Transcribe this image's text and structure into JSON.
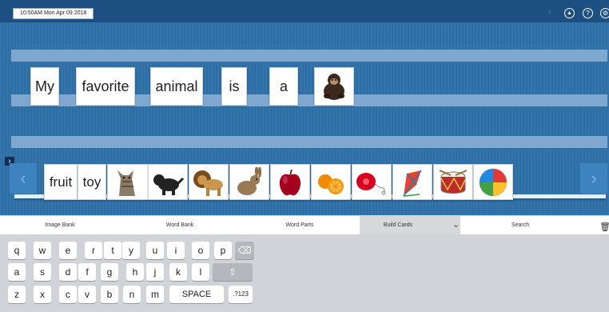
{
  "header": {
    "datetime": "10:50AM Mon Apr 09 2018",
    "icons": [
      "back-icon",
      "cloud-upload-icon",
      "help-icon",
      "gear-icon"
    ]
  },
  "sentence": {
    "words": [
      "My",
      "favorite",
      "animal",
      "is",
      "a"
    ],
    "image": "chimpanzee"
  },
  "bank": {
    "words": [
      "fruit",
      "toy"
    ],
    "images": [
      "cat",
      "puppy",
      "lion",
      "rabbit",
      "apple",
      "orange",
      "yo-yo",
      "kite",
      "drum",
      "beach-ball"
    ]
  },
  "tabs": {
    "image_bank": "Image Bank",
    "word_bank": "Word Bank",
    "word_parts": "Word Parts",
    "build_cards": "Build Cards",
    "search": "Search",
    "active": "Build Cards"
  },
  "keyboard": {
    "row1": [
      "q",
      "w",
      "e",
      "r",
      "t",
      "y",
      "u",
      "i",
      "o",
      "p"
    ],
    "row2": [
      "a",
      "s",
      "d",
      "f",
      "g",
      "h",
      "j",
      "k",
      "l"
    ],
    "row3": [
      "z",
      "x",
      "c",
      "v",
      "b",
      "n",
      "m"
    ],
    "space": "SPACE",
    "numbers": ".?123",
    "backspace_icon": "backspace-icon",
    "shift_icon": "shift-icon"
  },
  "colors": {
    "stage": "#2e6fa6",
    "topbar": "#1d4f82",
    "stripe": "#7ea8cf"
  }
}
